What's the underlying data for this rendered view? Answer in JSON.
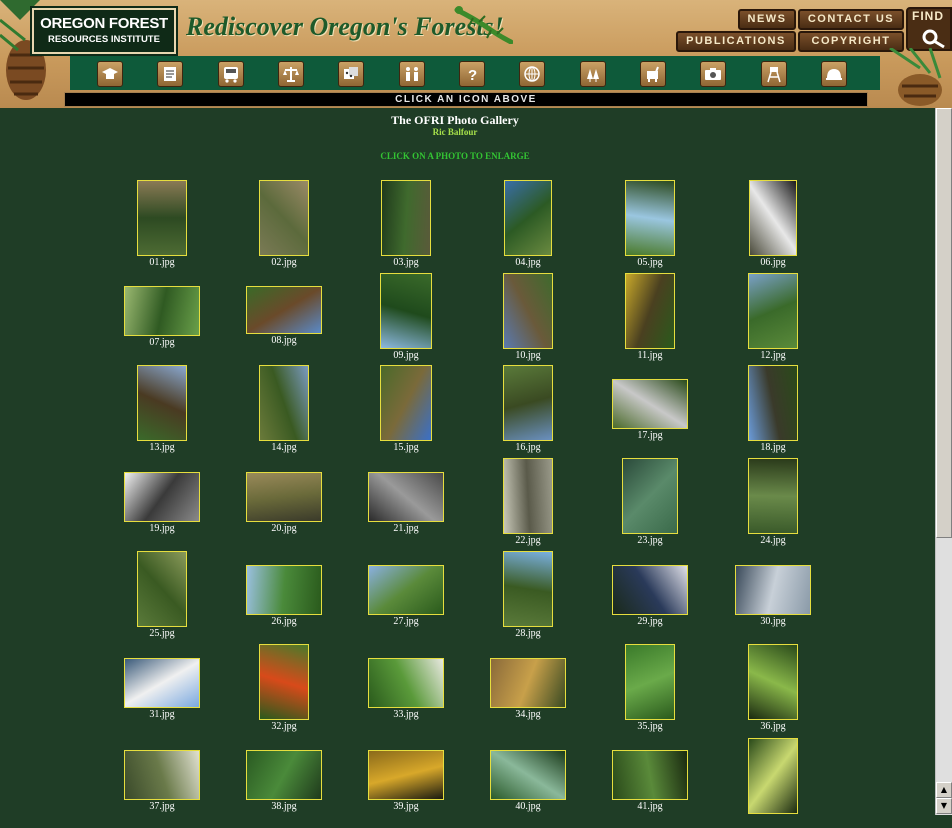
{
  "header": {
    "logo_line1": "OREGON FOREST",
    "logo_line2": "RESOURCES INSTITUTE",
    "tagline": "Rediscover Oregon's Forests!",
    "buttons": {
      "news": "NEWS",
      "contact": "CONTACT US",
      "publications": "PUBLICATIONS",
      "copyright": "COPYRIGHT",
      "find": "FIND"
    },
    "nav_icons": [
      "graduation-cap-icon",
      "notepad-icon",
      "bus-icon",
      "scales-icon",
      "dice-icon",
      "family-icon",
      "question-icon",
      "globe-icon",
      "trees-icon",
      "deer-icon",
      "camera-icon",
      "lookout-tower-icon",
      "helmet-icon"
    ],
    "click_bar": "CLICK AN ICON ABOVE"
  },
  "gallery": {
    "title": "The OFRI Photo Gallery",
    "credit": "Ric Balfour",
    "hint": "CLICK ON A PHOTO TO ENLARGE",
    "photos": [
      "01.jpg",
      "02.jpg",
      "03.jpg",
      "04.jpg",
      "05.jpg",
      "06.jpg",
      "07.jpg",
      "08.jpg",
      "09.jpg",
      "10.jpg",
      "11.jpg",
      "12.jpg",
      "13.jpg",
      "14.jpg",
      "15.jpg",
      "16.jpg",
      "17.jpg",
      "18.jpg",
      "19.jpg",
      "20.jpg",
      "21.jpg",
      "22.jpg",
      "23.jpg",
      "24.jpg",
      "25.jpg",
      "26.jpg",
      "27.jpg",
      "28.jpg",
      "29.jpg",
      "30.jpg",
      "31.jpg",
      "32.jpg",
      "33.jpg",
      "34.jpg",
      "35.jpg",
      "36.jpg",
      "37.jpg",
      "38.jpg",
      "39.jpg",
      "40.jpg",
      "41.jpg",
      ""
    ]
  },
  "colors": {
    "background": "#1f3d26",
    "thumb_border": "#e6de3e",
    "credit": "#a6e04a",
    "hint": "#33c433"
  }
}
